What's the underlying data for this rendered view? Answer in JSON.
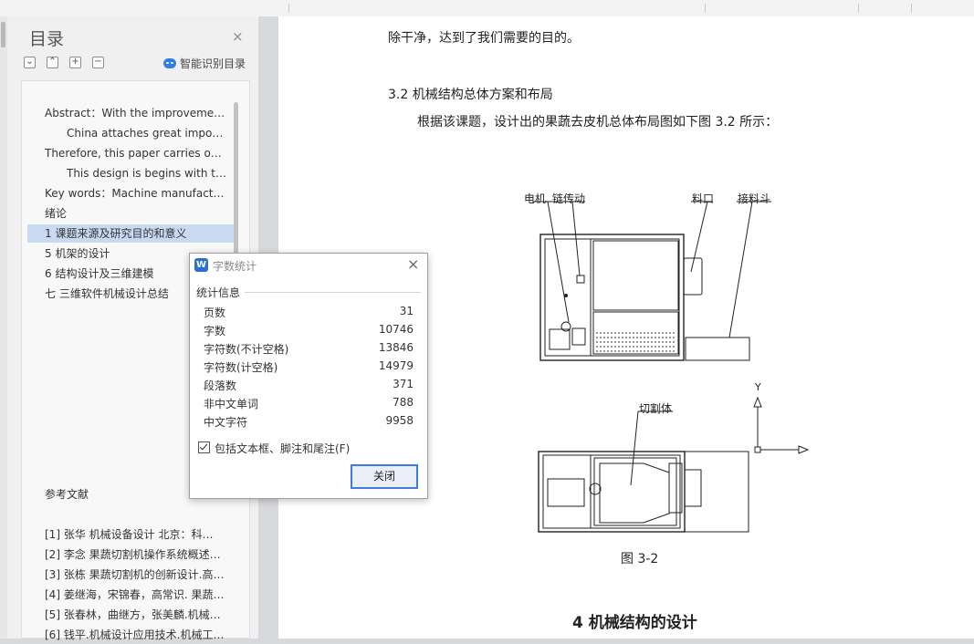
{
  "nav": {
    "title": "目录",
    "close_glyph": "×",
    "buttons": [
      {
        "name": "collapse-all",
        "glyph": "⌄"
      },
      {
        "name": "expand-all",
        "glyph": "⌃"
      },
      {
        "name": "add-heading",
        "glyph": "+"
      },
      {
        "name": "remove-heading",
        "glyph": "−"
      }
    ],
    "smart_recognize": "智能识别目录",
    "items": [
      {
        "label": "Abstract：With the improvemen…"
      },
      {
        "label": "China attaches great import…"
      },
      {
        "label": "Therefore, this paper carries on r…"
      },
      {
        "label": "This design is begins with th…"
      },
      {
        "label": "Key words：Machine manufactu…"
      },
      {
        "label": "绪论"
      },
      {
        "label": "1  课题来源及研究目的和意义"
      },
      {
        "label": "5  机架的设计"
      },
      {
        "label": "6  结构设计及三维建模"
      },
      {
        "label": "七  三维软件机械设计总结"
      },
      {
        "label": "参考文献"
      },
      {
        "label": "[1]  张华  机械设备设计  北京：科…"
      },
      {
        "label": "[2]  李念  果蔬切割机操作系统概述…"
      },
      {
        "label": "[3]  张栋  果蔬切割机的创新设计.高…"
      },
      {
        "label": "[4]  姜继海，宋锦春，高常识. 果蔬…"
      },
      {
        "label": "[5]  张春林，曲继方，张美麟.机械…"
      },
      {
        "label": "[6]  钱平.机械设计应用技术.机械工…"
      }
    ]
  },
  "doc": {
    "line1": "除干净，达到了我们需要的目的。",
    "section_heading": "3.2  机械结构总体方案和布局",
    "para": "根据该课题，设计出的果蔬去皮机总体布局图如下图 3.2 所示：",
    "labels": {
      "motor": "电机",
      "chain": "链传动",
      "inlet": "料口",
      "hopper": "接料斗",
      "cutter": "切割体",
      "axis_y": "Y"
    },
    "figure_caption": "图 3-2",
    "next_heading": "4  机械结构的设计"
  },
  "dialog": {
    "title": "字数统计",
    "logo": "W",
    "close_glyph": "×",
    "section": "统计信息",
    "stats": [
      {
        "label": "页数",
        "value": "31"
      },
      {
        "label": "字数",
        "value": "10746"
      },
      {
        "label": "字符数(不计空格)",
        "value": "13846"
      },
      {
        "label": "字符数(计空格)",
        "value": "14979"
      },
      {
        "label": "段落数",
        "value": "371"
      },
      {
        "label": "非中文单词",
        "value": "788"
      },
      {
        "label": "中文字符",
        "value": "9958"
      }
    ],
    "checkbox_label": "包括文本框、脚注和尾注(F)",
    "checkbox_checked": true,
    "close_button": "关闭"
  }
}
